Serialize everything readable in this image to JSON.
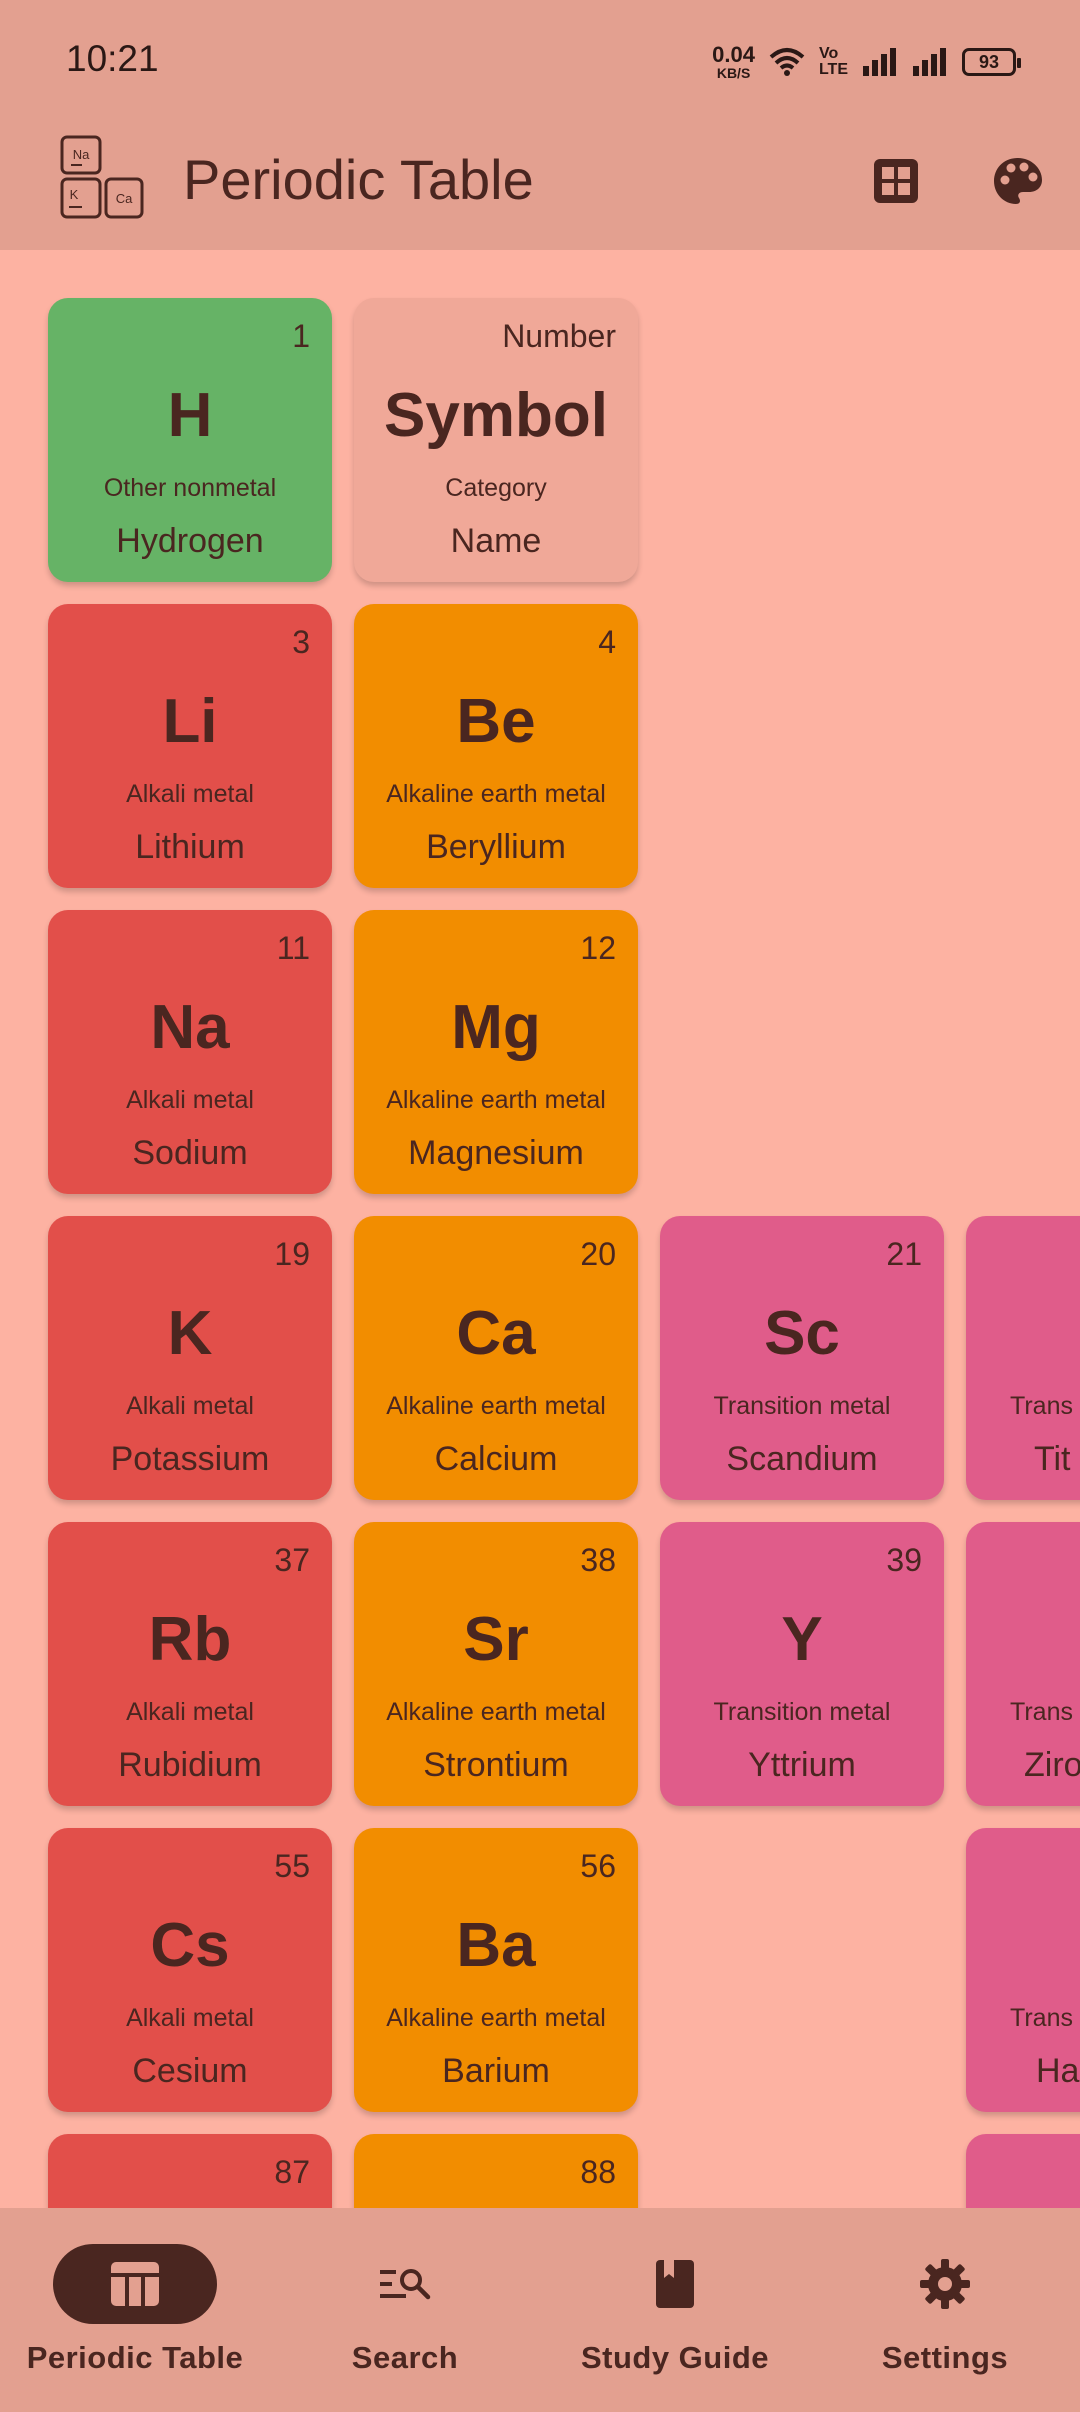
{
  "status_bar": {
    "time": "10:21",
    "net_speed_value": "0.04",
    "net_speed_unit": "KB/S",
    "volte_top": "Vo",
    "volte_bottom": "LTE",
    "battery": "93"
  },
  "app_bar": {
    "title": "Periodic Table",
    "logo_letters": [
      "Na",
      "K",
      "Ca"
    ]
  },
  "legend_tile": {
    "number": "Number",
    "symbol": "Symbol",
    "category": "Category",
    "name": "Name"
  },
  "elements": [
    {
      "number": "1",
      "symbol": "H",
      "category": "Other nonmetal",
      "name": "Hydrogen"
    },
    {
      "number": "3",
      "symbol": "Li",
      "category": "Alkali metal",
      "name": "Lithium"
    },
    {
      "number": "4",
      "symbol": "Be",
      "category": "Alkaline earth metal",
      "name": "Beryllium"
    },
    {
      "number": "11",
      "symbol": "Na",
      "category": "Alkali metal",
      "name": "Sodium"
    },
    {
      "number": "12",
      "symbol": "Mg",
      "category": "Alkaline earth metal",
      "name": "Magnesium"
    },
    {
      "number": "19",
      "symbol": "K",
      "category": "Alkali metal",
      "name": "Potassium"
    },
    {
      "number": "20",
      "symbol": "Ca",
      "category": "Alkaline earth metal",
      "name": "Calcium"
    },
    {
      "number": "21",
      "symbol": "Sc",
      "category": "Transition metal",
      "name": "Scandium"
    },
    {
      "number": "",
      "symbol": "",
      "category": "Trans",
      "name": "Tit"
    },
    {
      "number": "37",
      "symbol": "Rb",
      "category": "Alkali metal",
      "name": "Rubidium"
    },
    {
      "number": "38",
      "symbol": "Sr",
      "category": "Alkaline earth metal",
      "name": "Strontium"
    },
    {
      "number": "39",
      "symbol": "Y",
      "category": "Transition metal",
      "name": "Yttrium"
    },
    {
      "number": "",
      "symbol": "",
      "category": "Trans",
      "name": "Ziro"
    },
    {
      "number": "55",
      "symbol": "Cs",
      "category": "Alkali metal",
      "name": "Cesium"
    },
    {
      "number": "56",
      "symbol": "Ba",
      "category": "Alkaline earth metal",
      "name": "Barium"
    },
    {
      "number": "",
      "symbol": "",
      "category": "Trans",
      "name": "Ha"
    },
    {
      "number": "87",
      "symbol": "",
      "category": "",
      "name": ""
    },
    {
      "number": "88",
      "symbol": "",
      "category": "",
      "name": ""
    }
  ],
  "colors": {
    "other_nonmetal": "#66b366",
    "alkali_metal": "#e24f4a",
    "alkaline_earth_metal": "#f28d00",
    "transition_metal": "#e05c8a",
    "legend": "#f0a898",
    "background": "#fdb2a2",
    "bars": "#e3a090",
    "on_surface": "#4a2620"
  },
  "bottom_nav": {
    "items": [
      {
        "label": "Periodic Table",
        "icon": "table-icon",
        "active": true
      },
      {
        "label": "Search",
        "icon": "search-list-icon",
        "active": false
      },
      {
        "label": "Study Guide",
        "icon": "book-icon",
        "active": false
      },
      {
        "label": "Settings",
        "icon": "gear-icon",
        "active": false
      }
    ]
  }
}
